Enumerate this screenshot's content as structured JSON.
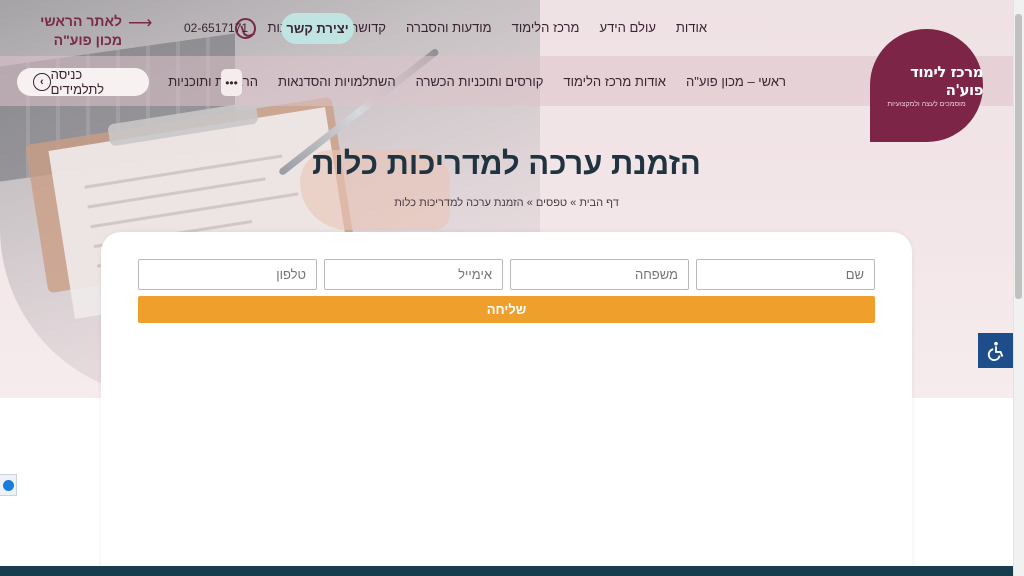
{
  "header": {
    "top_nav": [
      "אודות",
      "עולם הידע",
      "מרכז הלימוד",
      "מודעות והסברה",
      "קדושת החיים",
      "חנות"
    ],
    "contact_label": "יצירת קשר",
    "phone": "02-6517171",
    "back_link": "לאתר הראשי מכון פוע\"ה",
    "back_arrow": "⟶"
  },
  "main_nav": {
    "items": [
      "ראשי – מכון פוע\"ה",
      "אודות מרכז הלימוד",
      "קורסים ותוכניות הכשרה",
      "השתלמויות והסדנאות",
      "הרצאות ותוכניות"
    ],
    "more": "•••",
    "student_login": "כניסה לתלמידים",
    "student_icon": "‹"
  },
  "logo": {
    "title": "מרכז לימוד פוע'ה",
    "subtitle": "מוסמכים לעצה ולמקצועיות",
    "color": "#7c2546"
  },
  "page": {
    "title": "הזמנת ערכה למדריכות כלות",
    "breadcrumb": "דף הבית » טפסים » הזמנת ערכה למדריכות כלות"
  },
  "form": {
    "first_name_placeholder": "שם",
    "last_name_placeholder": "משפחה",
    "email_placeholder": "אימייל",
    "phone_placeholder": "טלפון",
    "submit_label": "שליחה",
    "submit_color": "#ef9f2b"
  },
  "widgets": {
    "accessibility_icon": "wheelchair-icon",
    "side_tab_icon": "chat-icon"
  }
}
